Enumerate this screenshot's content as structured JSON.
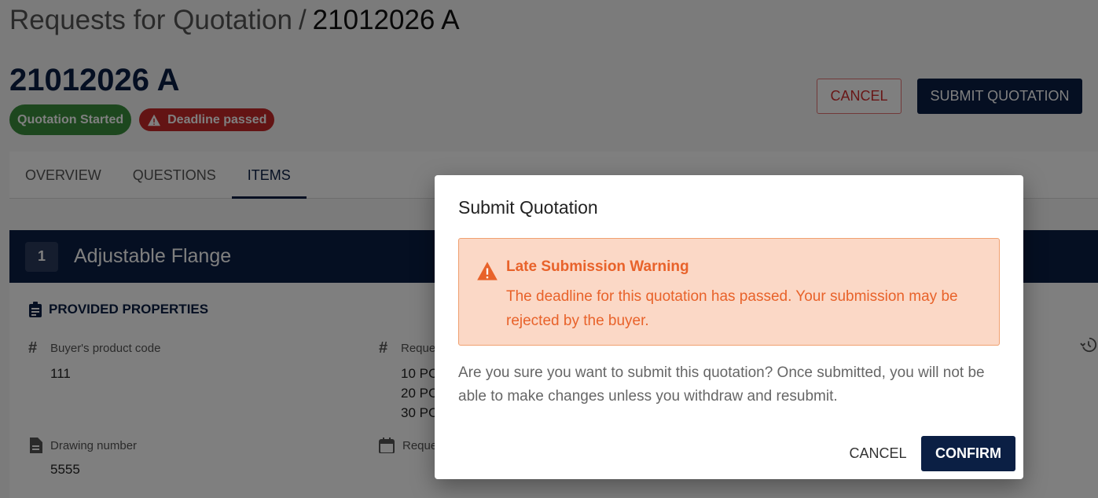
{
  "breadcrumb": {
    "parent": "Requests for Quotation",
    "separator": "/",
    "current": "21012026 A"
  },
  "rfq": {
    "title": "21012026 A"
  },
  "badges": {
    "status": "Quotation Started",
    "deadline": "Deadline passed"
  },
  "header": {
    "cancel_label": "CANCEL",
    "submit_label": "SUBMIT QUOTATION"
  },
  "tabs": [
    {
      "label": "OVERVIEW"
    },
    {
      "label": "QUESTIONS"
    },
    {
      "label": "ITEMS"
    }
  ],
  "item": {
    "number": "1",
    "name": "Adjustable Flange",
    "props_heading": "PROVIDED PROPERTIES",
    "properties": {
      "buyer_code_label": "Buyer's product code",
      "buyer_code_value": "111",
      "requested_label": "Reque",
      "requested_values": [
        "10 PC",
        "20 PC",
        "30 PC"
      ],
      "drawing_label": "Drawing number",
      "drawing_value": "5555",
      "request_date_label": "Reque"
    }
  },
  "dialog": {
    "title": "Submit Quotation",
    "warning_title": "Late Submission Warning",
    "warning_text": "The deadline for this quotation has passed. Your submission may be rejected by the buyer.",
    "body": "Are you sure you want to submit this quotation? Once submitted, you will not be able to make changes unless you withdraw and resubmit.",
    "cancel_label": "CANCEL",
    "confirm_label": "CONFIRM"
  },
  "colors": {
    "primary": "#0b1f44",
    "success": "#3a8f3d",
    "danger": "#c62828",
    "warning_text": "#e8622a",
    "warning_bg": "#fbd8c6"
  },
  "icons": {
    "badge_warning": "warning-icon",
    "props_heading": "clipboard-icon",
    "code": "hash-icon",
    "drawing": "document-icon",
    "date": "calendar-icon",
    "history": "history-icon",
    "dialog_warning": "warning-icon"
  }
}
